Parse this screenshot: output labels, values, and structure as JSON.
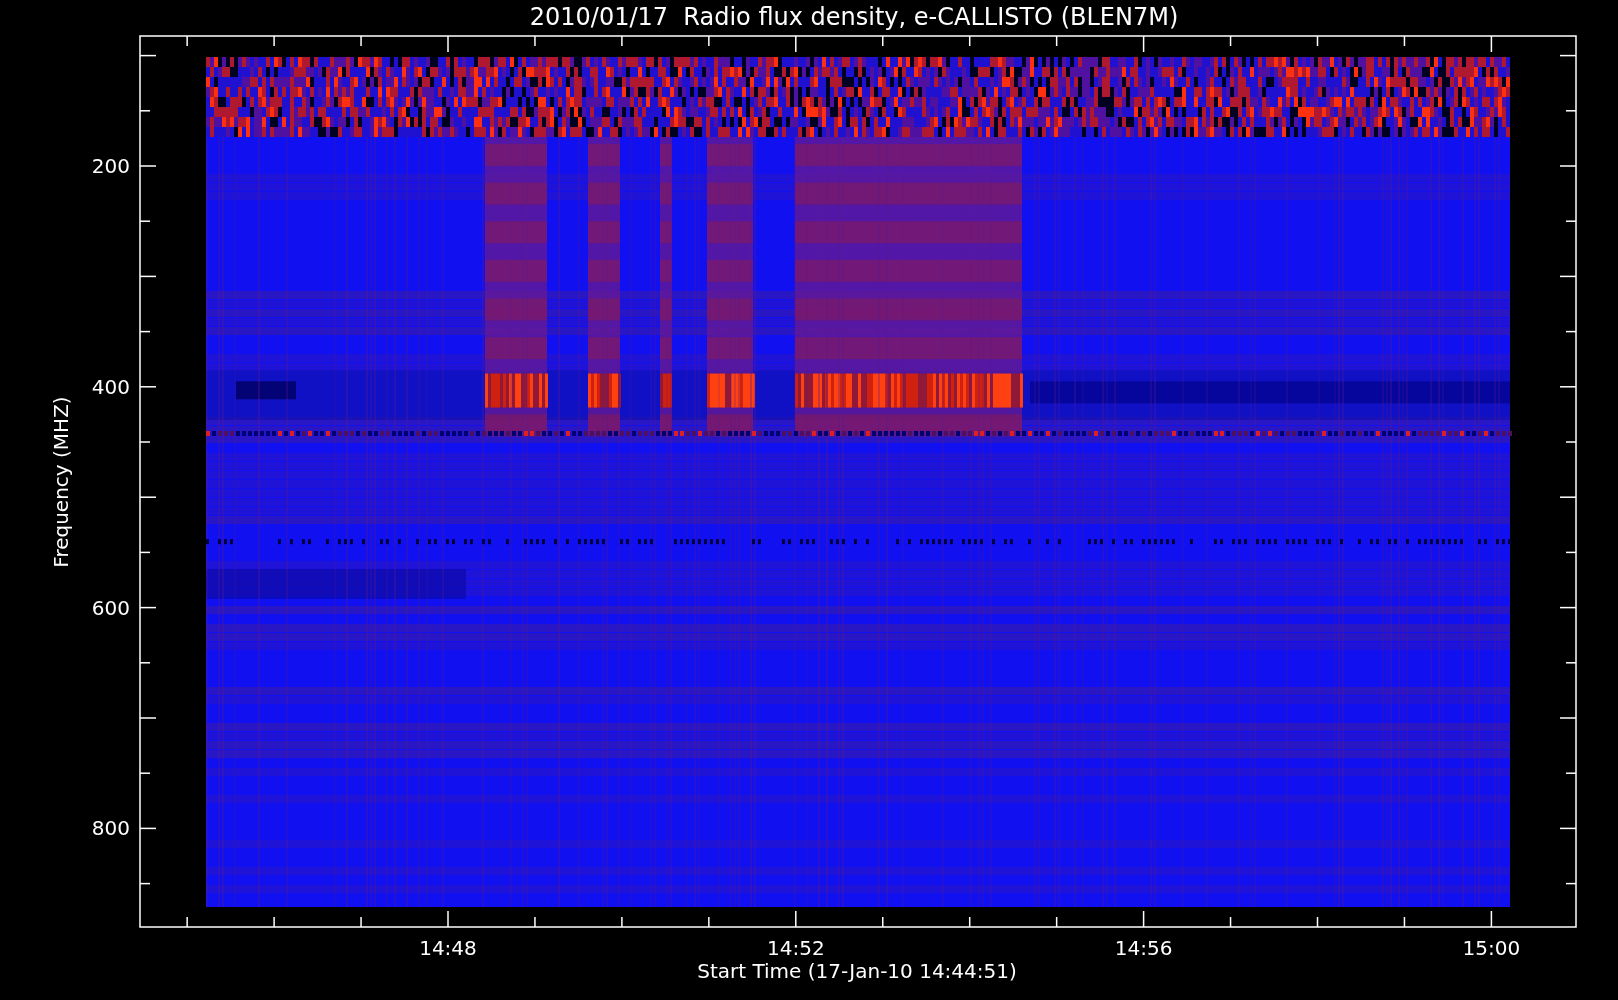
{
  "title": "2010/01/17  Radio flux density, e-CALLISTO (BLEN7M)",
  "y_axis": {
    "label": "Frequency (MHZ)",
    "ticks": [
      "200",
      "400",
      "600",
      "800"
    ]
  },
  "x_axis": {
    "label": "Start Time (17-Jan-10 14:44:51)",
    "ticks": [
      "14:48",
      "14:52",
      "14:56",
      "15:00"
    ]
  }
}
